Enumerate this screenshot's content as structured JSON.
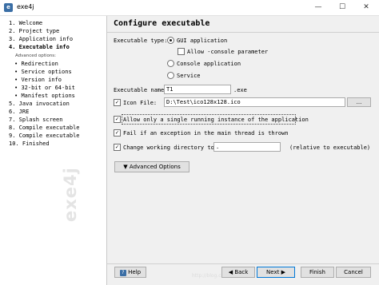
{
  "window": {
    "title": "exe4j",
    "minimize": "—",
    "maximize": "☐",
    "close": "✕"
  },
  "sidebar": {
    "steps": [
      "1.  Welcome",
      "2.  Project type",
      "3.  Application info",
      "4.  Executable info",
      "Redirection",
      "Service options",
      "Version info",
      "32-bit or 64-bit",
      "Manifest options",
      "5.  Java invocation",
      "6.  JRE",
      "7.  Splash screen",
      "8.  Compile executable",
      "9.  Compile executable",
      "10. Finished"
    ],
    "advanced_label": "Advanced options:",
    "watermark": "exe4j"
  },
  "page": {
    "title": "Configure executable",
    "exec_type_label": "Executable type:",
    "gui_app": "GUI application",
    "allow_console": "Allow -console parameter",
    "console_app": "Console application",
    "service": "Service",
    "exec_name_label": "Executable name:",
    "exec_name_value": "T1",
    "exec_ext": ".exe",
    "icon_file_label": "Icon File:",
    "icon_file_value": "D:\\Test\\ico128x128.ico",
    "browse": "...",
    "allow_single": "Allow only a single running instance of the application",
    "fail_exception": "Fail if an exception in the main thread is thrown",
    "change_dir": "Change working directory to:",
    "change_dir_value": ".",
    "relative": "(relative to executable)",
    "advanced_options": "Advanced Options"
  },
  "footer": {
    "help": "Help",
    "back": "Back",
    "next": "Next",
    "finish": "Finish",
    "cancel": "Cancel",
    "watermark": "http://blog.csdn.net/"
  }
}
